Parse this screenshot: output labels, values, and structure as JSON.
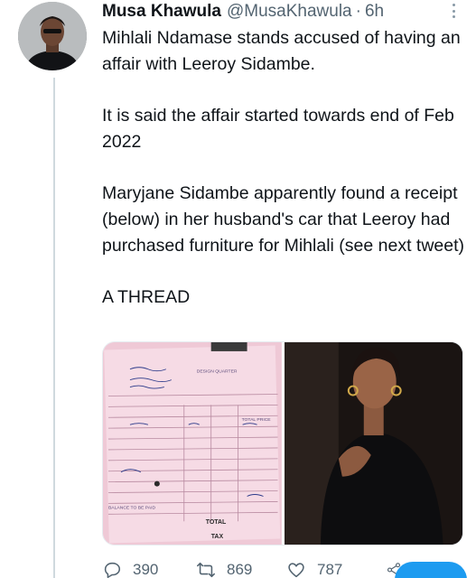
{
  "tweet": {
    "display_name": "Musa Khawula",
    "handle": "@MusaKhawula",
    "separator": "·",
    "time": "6h",
    "paragraphs": [
      "Mihlali Ndamase stands accused of having an affair with Leeroy Sidambe.",
      "It is said the affair started towards end of Feb 2022",
      "Maryjane Sidambe apparently found a receipt (below) in her husband's car that Leeroy had purchased furniture for Mihlali (see next tweet)",
      "A THREAD"
    ]
  },
  "media": {
    "left_image": "receipt-photo",
    "right_image": "portrait-photo",
    "receipt_texts": [
      "DESIGN QUARTER",
      "TOTAL PRICE",
      "TOTAL",
      "TAX",
      "BALANCE TO BE PAID"
    ]
  },
  "actions": {
    "reply_count": "390",
    "retweet_count": "869",
    "like_count": "787"
  },
  "icons": {
    "reply": "reply-icon",
    "retweet": "retweet-icon",
    "like": "heart-icon",
    "share": "share-icon",
    "more": "more-options-icon"
  },
  "colors": {
    "text": "#0f1419",
    "muted": "#536471",
    "accent": "#1d9bf0",
    "thread_line": "#cfd9de"
  }
}
